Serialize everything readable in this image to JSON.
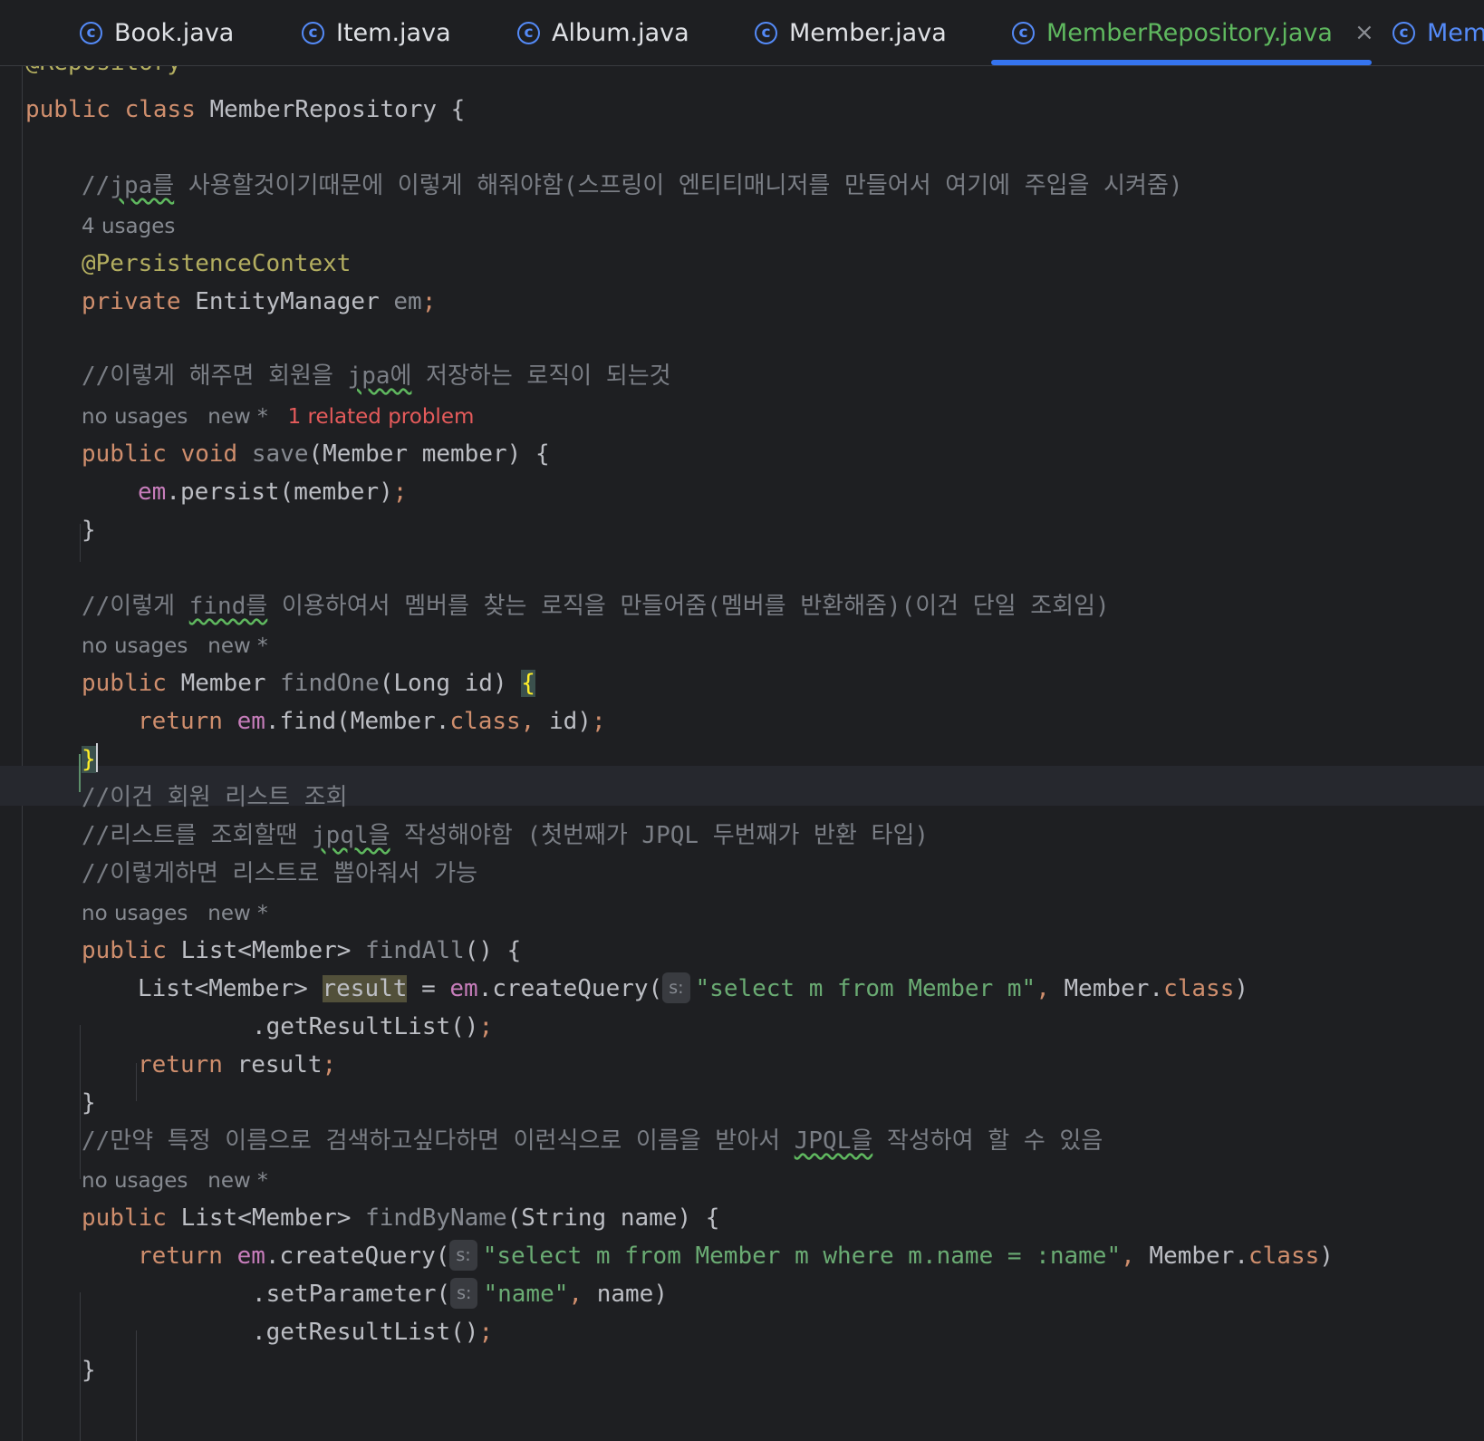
{
  "tabs": [
    {
      "label": "Book.java"
    },
    {
      "label": "Item.java"
    },
    {
      "label": "Album.java"
    },
    {
      "label": "Member.java"
    },
    {
      "label": "MemberRepository.java",
      "active": true
    },
    {
      "label": "Mem"
    }
  ],
  "tab_close_glyph": "×",
  "tab_icon_glyph": "c",
  "code": {
    "l0": "@Repository",
    "l1_kw1": "public",
    "l1_kw2": "class",
    "l1_name": "MemberRepository",
    "l1_brace": "{",
    "c1_pre": "//",
    "c1_sq": "jpa를",
    "c1_rest": " 사용할것이기때문에 이렇게 해줘야함(스프링이 엔티티매니저를 만들어서 여기에 주입을 시켜줌)",
    "h1": "4 usages",
    "ann1": "@PersistenceContext",
    "f_kw": "private",
    "f_type": "EntityManager",
    "f_name": "em",
    "f_semi": ";",
    "c2_pre": "//이렇게 해주면 회원을 ",
    "c2_sq": "jpa에",
    "c2_rest": " 저장하는 로직이 되는것",
    "h2_a": "no usages",
    "h2_b": "new *",
    "h2_err": "1 related problem",
    "s_kw1": "public",
    "s_kw2": "void",
    "s_name": "save",
    "s_sig": "(Member member) {",
    "s_body_em": "em",
    "s_body_rest": ".persist(member)",
    "s_semi": ";",
    "s_close": "}",
    "c3_pre": "//이렇게 ",
    "c3_sq": "find를",
    "c3_rest": " 이용하여서 멤버를 찾는 로직을 만들어줌(멤버를 반환해줌)(이건 단일 조회임)",
    "h3_a": "no usages",
    "h3_b": "new *",
    "o_kw": "public",
    "o_type": "Member",
    "o_name": "findOne",
    "o_sig": "(Long id) ",
    "o_brace": "{",
    "o_ret": "return",
    "o_em": "em",
    "o_mid": ".find(Member.",
    "o_cls": "class",
    "o_comma": ",",
    "o_end": " id)",
    "o_semi": ";",
    "o_close": "}",
    "c4": "//이건 회원 리스트 조회",
    "c5_pre": "//리스트를 조회할땐 ",
    "c5_sq": "jpql을",
    "c5_rest": " 작성해야함 (첫번째가 JPQL 두번째가 반환 타입)",
    "c6": "//이렇게하면 리스트로 뽑아줘서 가능",
    "h4_a": "no usages",
    "h4_b": "new *",
    "a_kw": "public",
    "a_type": "List<Member>",
    "a_name": "findAll",
    "a_sig": "() {",
    "a1_type": "List<Member> ",
    "a1_var": "result",
    "a1_eq": " = ",
    "a1_em": "em",
    "a1_call": ".createQuery(",
    "pill": "s:",
    "a1_str": "\"select m from Member m\"",
    "a1_comma": ", ",
    "a1_cls_pre": "Member.",
    "a1_cls": "class",
    "a1_end": ")",
    "a2": ".getResultList()",
    "a2_semi": ";",
    "a3_ret": "return",
    "a3_var": " result",
    "a3_semi": ";",
    "a_close": "}",
    "c7_pre": "//만약 특정 이름으로 검색하고싶다하면 이런식으로 이름을 받아서 ",
    "c7_sq": "JPQL을",
    "c7_rest": " 작성하여 할 수 있음",
    "h5_a": "no usages",
    "h5_b": "new *",
    "n_kw": "public",
    "n_type": "List<Member>",
    "n_name": "findByName",
    "n_sig": "(String name) {",
    "n1_ret": "return",
    "n1_em": " em",
    "n1_call": ".createQuery(",
    "n1_str": "\"select m from Member m where m.name = :name\"",
    "n1_comma": ", ",
    "n1_cls_pre": "Member.",
    "n1_cls": "class",
    "n1_end": ")",
    "n2_call": ".setParameter(",
    "n2_str": "\"name\"",
    "n2_comma": ",",
    "n2_end": " name)",
    "n3": ".getResultList()",
    "n3_semi": ";",
    "n_close": "}"
  },
  "colors": {
    "keyword": "#cf8e6d",
    "annotation": "#b3ae60",
    "string": "#6aab73",
    "comment": "#7a7e85",
    "field": "#c77dbb",
    "active_tab": "#5fb85f",
    "error": "#e55b5b"
  }
}
